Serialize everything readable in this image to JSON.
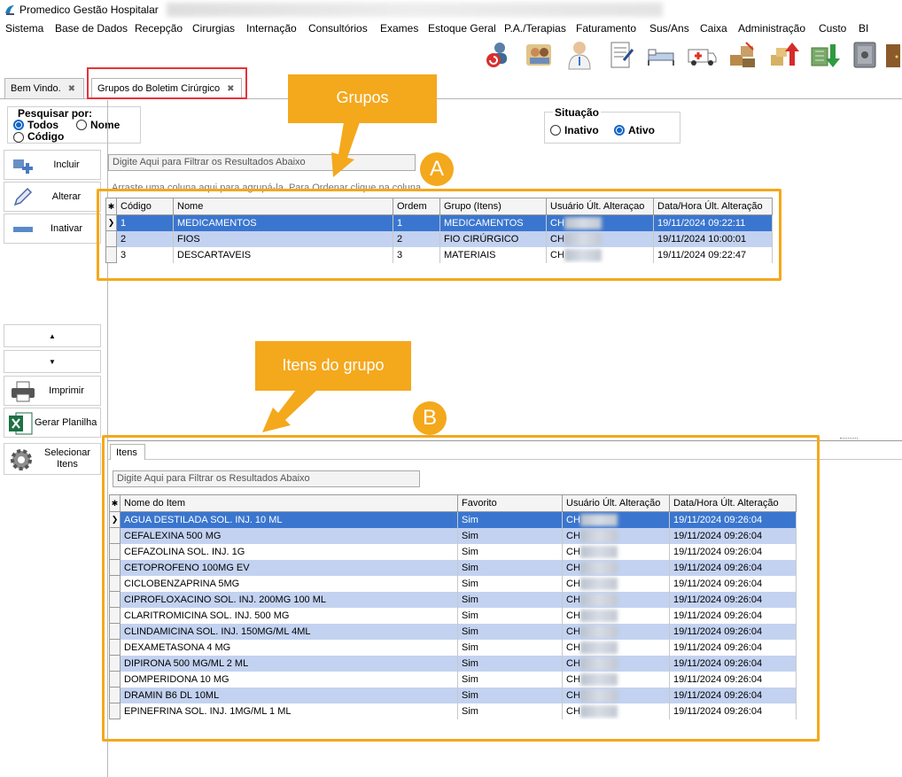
{
  "window": {
    "title": "Promedico Gestão Hospitalar"
  },
  "menu": [
    "Sistema",
    "Base de Dados",
    "Recepção",
    "Cirurgias",
    "Internação",
    "Consultórios",
    "Exames",
    "Estoque Geral",
    "P.A./Terapias",
    "Faturamento",
    "Sus/Ans",
    "Caixa",
    "Administração",
    "Custo",
    "BI"
  ],
  "toolbar": [
    "users-refresh-icon",
    "patients-icon",
    "doctor-icon",
    "prescription-icon",
    "bed-icon",
    "ambulance-icon",
    "stock-up-icon",
    "stock-boxes-icon",
    "money-down-icon",
    "safe-icon",
    "exit-door-icon"
  ],
  "tabs": [
    {
      "label": "Bem Vindo.",
      "close": "✖"
    },
    {
      "label": "Grupos do Boletim Cirúrgico",
      "close": "✖"
    }
  ],
  "search": {
    "title": "Pesquisar por:",
    "options": [
      "Todos",
      "Nome",
      "Código"
    ],
    "selected": "Todos"
  },
  "situacao": {
    "title": "Situação",
    "options": [
      "Inativo",
      "Ativo"
    ],
    "selected": "Ativo"
  },
  "actions": {
    "incluir": "Incluir",
    "alterar": "Alterar",
    "inativar": "Inativar",
    "up": "▲",
    "down": "▼",
    "imprimir": "Imprimir",
    "gerar_planilha": "Gerar Planilha",
    "selecionar_itens": "Selecionar Itens"
  },
  "groups": {
    "filter_placeholder": "Digite Aqui para Filtrar os Resultados Abaixo",
    "group_hint": "Arraste uma coluna aqui para agrupá-la. Para Ordenar clique na coluna.",
    "columns": [
      "Código",
      "Nome",
      "Ordem",
      "Grupo (Itens)",
      "Usuário Últ. Alteraçao",
      "Data/Hora Últ. Alteração"
    ],
    "rows": [
      [
        "1",
        "MEDICAMENTOS",
        "1",
        "MEDICAMENTOS",
        "CH",
        "19/11/2024 09:22:11"
      ],
      [
        "2",
        "FIOS",
        "2",
        "FIO CIRÚRGICO",
        "CH",
        "19/11/2024 10:00:01"
      ],
      [
        "3",
        "DESCARTAVEIS",
        "3",
        "MATERIAIS",
        "CH",
        "19/11/2024 09:22:47"
      ]
    ]
  },
  "items": {
    "tab": "Itens",
    "filter_placeholder": "Digite Aqui para Filtrar os Resultados Abaixo",
    "columns": [
      "Nome do Item",
      "Favorito",
      "Usuário Últ. Alteração",
      "Data/Hora Últ. Alteração"
    ],
    "rows": [
      [
        "AGUA DESTILADA SOL. INJ. 10 ML",
        "Sim",
        "CH",
        "19/11/2024 09:26:04"
      ],
      [
        "CEFALEXINA 500 MG",
        "Sim",
        "CH",
        "19/11/2024 09:26:04"
      ],
      [
        "CEFAZOLINA SOL. INJ. 1G",
        "Sim",
        "CH",
        "19/11/2024 09:26:04"
      ],
      [
        "CETOPROFENO 100MG EV",
        "Sim",
        "CH",
        "19/11/2024 09:26:04"
      ],
      [
        "CICLOBENZAPRINA 5MG",
        "Sim",
        "CH",
        "19/11/2024 09:26:04"
      ],
      [
        "CIPROFLOXACINO SOL. INJ. 200MG 100 ML",
        "Sim",
        "CH",
        "19/11/2024 09:26:04"
      ],
      [
        "CLARITROMICINA SOL. INJ. 500 MG",
        "Sim",
        "CH",
        "19/11/2024 09:26:04"
      ],
      [
        "CLINDAMICINA SOL. INJ. 150MG/ML 4ML",
        "Sim",
        "CH",
        "19/11/2024 09:26:04"
      ],
      [
        "DEXAMETASONA 4 MG",
        "Sim",
        "CH",
        "19/11/2024 09:26:04"
      ],
      [
        "DIPIRONA  500 MG/ML 2 ML",
        "Sim",
        "CH",
        "19/11/2024 09:26:04"
      ],
      [
        "DOMPERIDONA 10 MG",
        "Sim",
        "CH",
        "19/11/2024 09:26:04"
      ],
      [
        "DRAMIN B6 DL  10ML",
        "Sim",
        "CH",
        "19/11/2024 09:26:04"
      ],
      [
        "EPINEFRINA  SOL. INJ. 1MG/ML 1 ML",
        "Sim",
        "CH",
        "19/11/2024 09:26:04"
      ]
    ]
  },
  "annotations": {
    "callout_a": "Grupos",
    "badge_a": "A",
    "callout_b": "Itens do grupo",
    "badge_b": "B"
  },
  "colors": {
    "selected_row": "#3a76cf",
    "alt_row": "#c3d2f0",
    "annotation": "#f4a81c",
    "highlight_frame": "#e8323a"
  }
}
